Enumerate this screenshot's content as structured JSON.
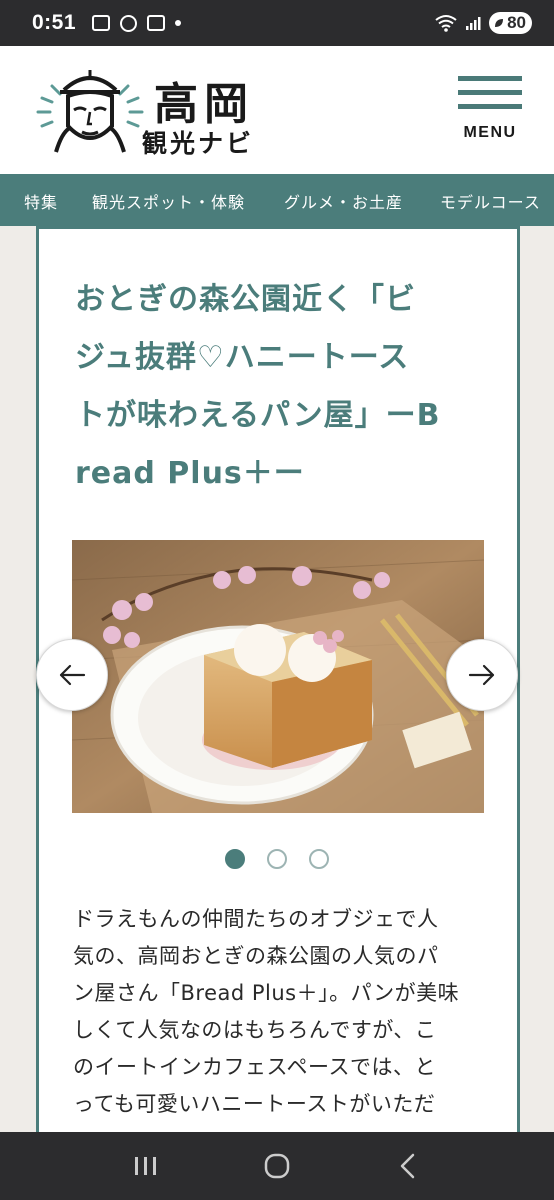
{
  "status_bar": {
    "time": "0:51",
    "battery": "80"
  },
  "header": {
    "logo_title": "高岡",
    "logo_subtitle": "観光ナビ",
    "menu_label": "MENU"
  },
  "nav": {
    "items": [
      "特集",
      "観光スポット・体験",
      "グルメ・お土産",
      "モデルコース"
    ]
  },
  "article": {
    "title_lines": [
      "おとぎの森公園近く「ビ",
      "ジュ抜群♡ハニートース",
      "トが味わえるパン屋」ーB",
      "read Plus＋ー"
    ],
    "body_lines": [
      "ドラえもんの仲間たちのオブジェで人",
      "気の、高岡おとぎの森公園の人気のパ",
      "ン屋さん「Bread Plus＋」。パンが美味",
      "しくて人気なのはもちろんですが、こ",
      "のイートインカフェスペースでは、と",
      "っても可愛いハニートーストがいただ"
    ]
  },
  "slider": {
    "current": 1,
    "total": 3
  },
  "colors": {
    "accent": "#4b7d7b",
    "status_bar": "#2c2c2e"
  }
}
